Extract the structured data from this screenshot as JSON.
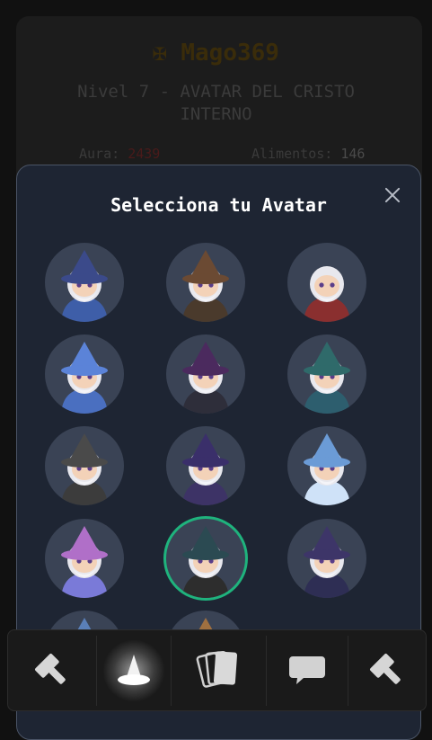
{
  "profile": {
    "title_icon": "maltese-cross-icon",
    "title": "✠ Mago369",
    "level_line": "Nivel 7 - AVATAR DEL CRISTO INTERNO",
    "aura_label": "Aura:",
    "aura_value": "2439",
    "food_label": "Alimentos:",
    "food_value": "146"
  },
  "modal": {
    "title": "Selecciona tu Avatar",
    "close_icon": "close-icon",
    "selected_index": 10,
    "avatars": [
      {
        "name": "wizard-blue-hat-stars",
        "hat": "#3b4a8a",
        "robe": "#3e5ea8"
      },
      {
        "name": "wizard-brown-hat",
        "hat": "#6b4a33",
        "robe": "#4a3a2c"
      },
      {
        "name": "wizard-white-hair-red-robe",
        "hat": "none",
        "robe": "#8a2f2f"
      },
      {
        "name": "wizard-blue-robe-staff",
        "hat": "#5b83d8",
        "robe": "#4a6fc0"
      },
      {
        "name": "wizard-purple-hat-dark",
        "hat": "#4b2a5e",
        "robe": "#2e2e3a"
      },
      {
        "name": "wizard-teal-robe-glasses",
        "hat": "#2f6a6a",
        "robe": "#2d5e6e"
      },
      {
        "name": "wizard-grey-hood-staff",
        "hat": "#4a4a4a",
        "robe": "#3c3c3c"
      },
      {
        "name": "wizard-purple-hat-girl",
        "hat": "#3a2f6a",
        "robe": "#3d3366"
      },
      {
        "name": "wizard-ice-blue-robe",
        "hat": "#6b9bd6",
        "robe": "#cfe2f8"
      },
      {
        "name": "wizard-pink-hat",
        "hat": "#b06fc8",
        "robe": "#7a7ad8"
      },
      {
        "name": "wizard-teal-hat-selected",
        "hat": "#2b4a52",
        "robe": "#2d2d2d"
      },
      {
        "name": "wizard-purple-hat-wand",
        "hat": "#3d3568",
        "robe": "#2e2e54"
      },
      {
        "name": "wizard-blue-hat-partial",
        "hat": "#5a7fb8",
        "robe": "#4a6fa8"
      },
      {
        "name": "wizard-brown-hat-partial",
        "hat": "#a07040",
        "robe": "#7a5530"
      }
    ]
  },
  "bottom_nav": {
    "items": [
      {
        "name": "hammer-icon",
        "active": false
      },
      {
        "name": "wizard-hat-icon",
        "active": true
      },
      {
        "name": "cards-icon",
        "active": false
      },
      {
        "name": "chat-bubble-icon",
        "active": false
      },
      {
        "name": "hammer-icon",
        "active": false
      }
    ]
  },
  "colors": {
    "accent_selected": "#1fb37d",
    "modal_bg": "#1e2533",
    "avatar_bg": "#3a4355"
  }
}
